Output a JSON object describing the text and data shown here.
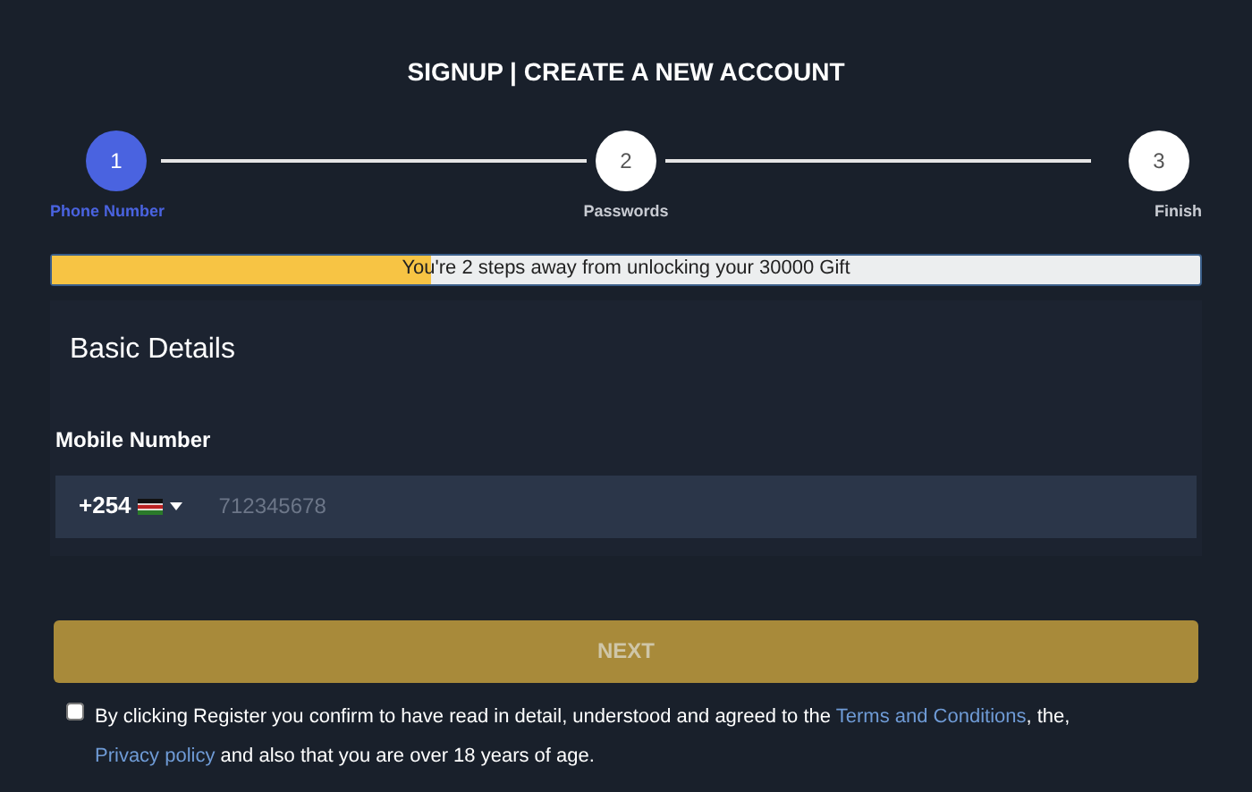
{
  "title": "SIGNUP | CREATE A NEW ACCOUNT",
  "steps": [
    {
      "number": "1",
      "label": "Phone Number",
      "selected": true
    },
    {
      "number": "2",
      "label": "Passwords",
      "selected": false
    },
    {
      "number": "3",
      "label": "Finish",
      "selected": false
    }
  ],
  "progress": {
    "level": 0.33,
    "text": "You're 2 steps away from unlocking your 30000 Gift"
  },
  "section_title": "Basic Details",
  "mobile": {
    "label": "Mobile Number",
    "code": "+254",
    "placeholder": "712345678"
  },
  "next_button": {
    "label": "NEXT",
    "disabled": true
  },
  "terms": {
    "checked": false,
    "before": "By clicking Register you confirm to have read in detail, understood and agreed to the ",
    "link1": "Terms and Conditions",
    "middle": ", the,",
    "link2": "Privacy policy",
    "after": " and also that you are over 18 years of age."
  }
}
